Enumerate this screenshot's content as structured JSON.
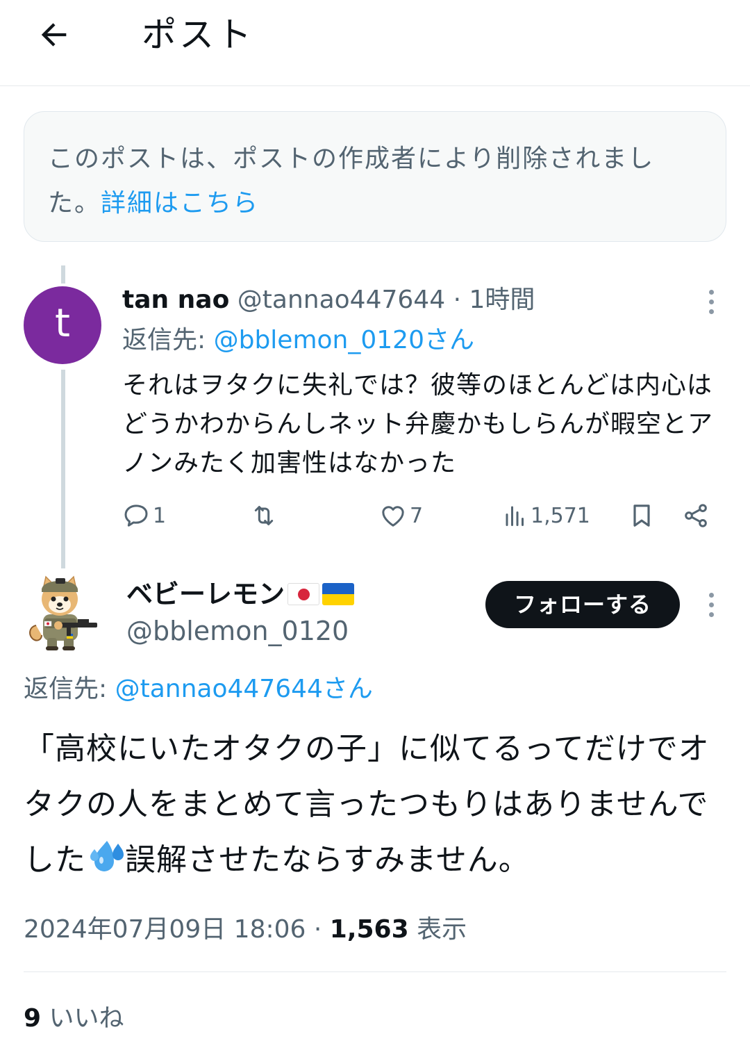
{
  "header": {
    "back_icon": "arrow-left-icon",
    "title": "ポスト"
  },
  "notice": {
    "text": "このポストは、ポストの作成者により削除されました。",
    "link": "詳細はこちら"
  },
  "reply_tweet": {
    "avatar_letter": "t",
    "avatar_color": "#7b2a9e",
    "name": "tan nao",
    "handle": "@tannao447644",
    "time": "· 1時間",
    "reply_to_label": "返信先:",
    "reply_to_link": "@bblemon_0120さん",
    "text": "それはヲタクに失礼では？彼等のほとんどは内心はどうかわからんしネット弁慶かもしらんが暇空とアノンみたく加害性はなかった",
    "actions": {
      "reply_count": "1",
      "repost_count": "",
      "like_count": "7",
      "views_count": "1,571"
    }
  },
  "main_tweet": {
    "name": "ベビーレモン",
    "flags": [
      "jp-flag",
      "ua-flag"
    ],
    "handle": "@bblemon_0120",
    "follow_label": "フォローする",
    "reply_to_label": "返信先:",
    "reply_to_link": "@tannao447644さん",
    "text_part1": "「高校にいたオタクの子」に似てるってだけでオタクの人をまとめて言ったつもりはありませんでした",
    "text_part2": "誤解させたならすみません。",
    "timestamp": "2024年07月09日 18:06 ·",
    "views_count": "1,563",
    "views_label": "表示",
    "likes_count": "9",
    "likes_label": "いいね"
  },
  "colors": {
    "accent": "#1d9bf0",
    "secondary_text": "#536471",
    "primary_text": "#0f1419"
  }
}
